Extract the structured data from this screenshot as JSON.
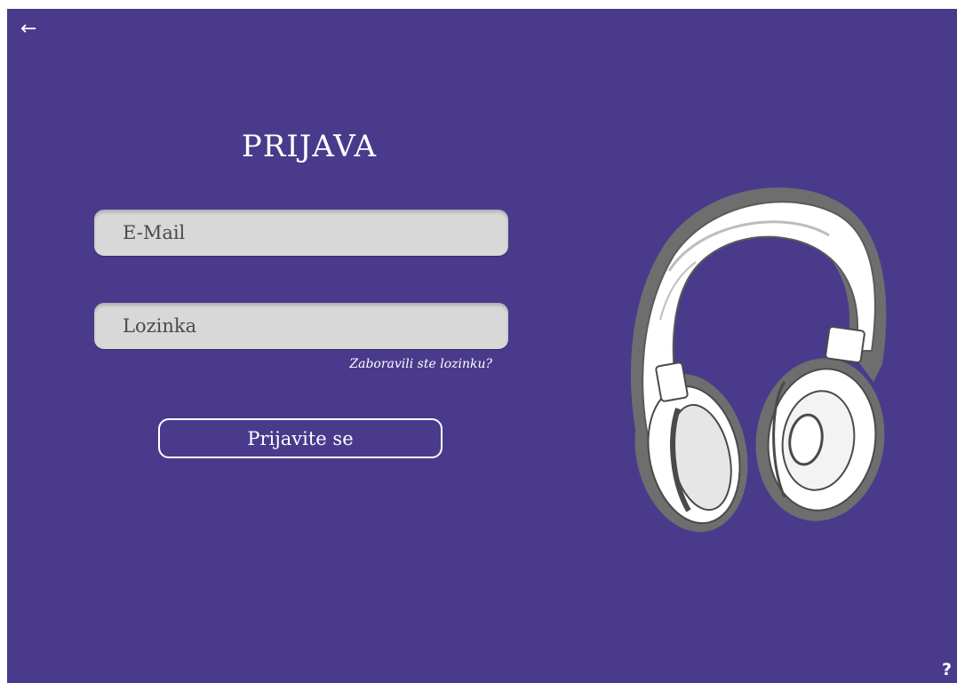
{
  "nav": {
    "back_icon": "arrow-left-icon",
    "back_glyph": "←"
  },
  "login": {
    "title": "PRIJAVA",
    "email_placeholder": "E-Mail",
    "password_placeholder": "Lozinka",
    "forgot_password": "Zaboravili ste lozinku?",
    "submit_label": "Prijavite se"
  },
  "illustration": {
    "icon": "headphones-icon"
  },
  "help": {
    "icon": "question-mark-icon",
    "glyph": "?"
  },
  "colors": {
    "background": "#4a3a8c",
    "field": "#d8d8d8",
    "text": "#ffffff"
  }
}
